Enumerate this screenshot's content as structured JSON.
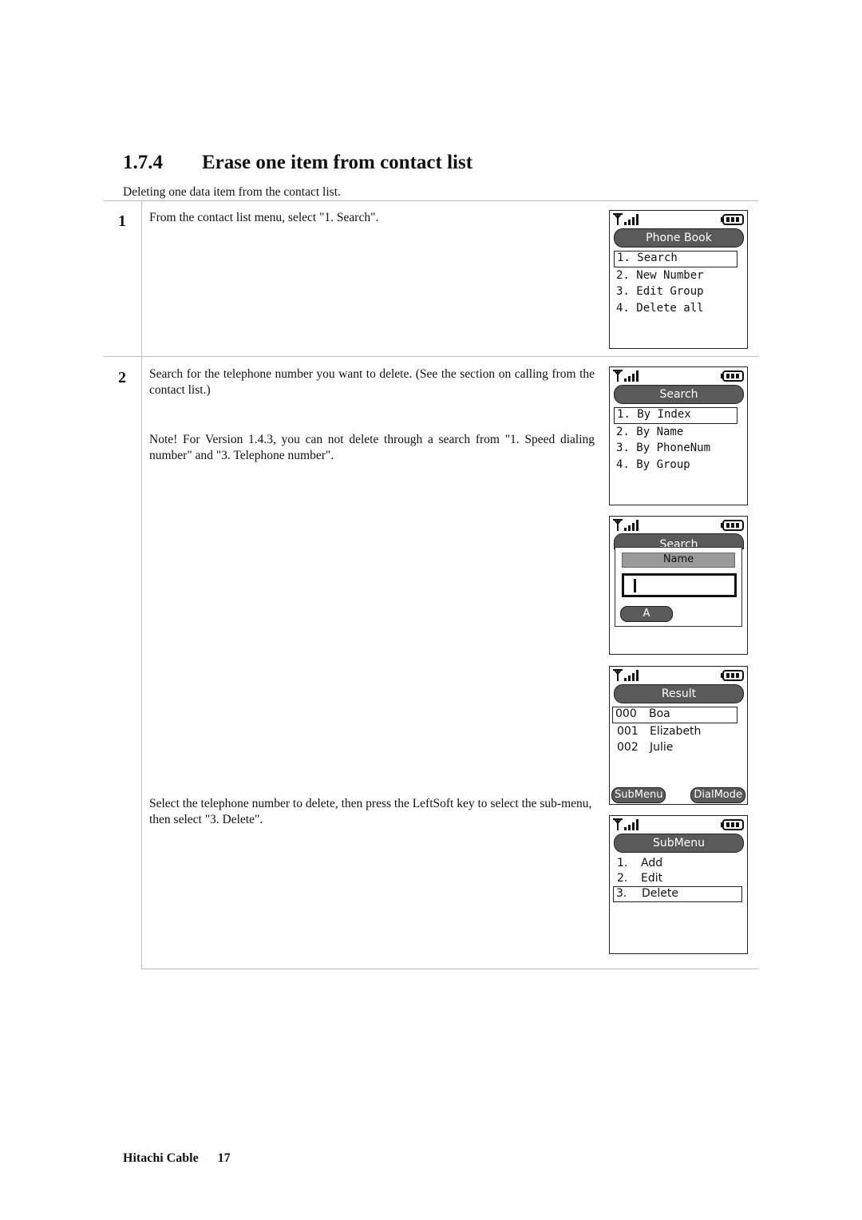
{
  "section": {
    "number": "1.7.4",
    "title": "Erase one item from contact list",
    "intro": "Deleting one data item from the contact list."
  },
  "steps": [
    {
      "number": "1",
      "paragraphs": [
        "From the contact list menu, select \"1. Search\"."
      ]
    },
    {
      "number": "2",
      "paragraphs": [
        "Search for the telephone number you want to delete. (See the section on calling from the contact list.)",
        "Note!  For Version 1.4.3, you can not delete through a search from \"1. Speed dialing number\" and \"3. Telephone number\".",
        "Select the telephone number to delete, then press the LeftSoft key to select the sub-menu, then select \"3. Delete\"."
      ]
    }
  ],
  "screens": {
    "phone_book": {
      "title": "Phone Book",
      "items": [
        "1. Search",
        "2. New Number",
        "3. Edit Group",
        "4. Delete all"
      ],
      "selected_index": 0
    },
    "search": {
      "title": "Search",
      "items": [
        "1. By Index",
        "2. By Name",
        "3. By PhoneNum",
        "4. By Group"
      ],
      "selected_index": 0
    },
    "search_name": {
      "title": "Search",
      "field_label": "Name",
      "input_value": "",
      "input_mode": "A"
    },
    "result": {
      "title": "Result",
      "rows": [
        {
          "index": "000",
          "name": "Boa"
        },
        {
          "index": "001",
          "name": "Elizabeth"
        },
        {
          "index": "002",
          "name": "Julie"
        }
      ],
      "selected_index": 0,
      "left_softkey": "SubMenu",
      "right_softkey": "DialMode"
    },
    "submenu": {
      "title": "SubMenu",
      "items": [
        {
          "index": "1.",
          "label": "Add"
        },
        {
          "index": "2.",
          "label": "Edit"
        },
        {
          "index": "3.",
          "label": "Delete"
        }
      ],
      "selected_index": 2
    }
  },
  "status_icons": [
    "signal-strength-icon",
    "battery-icon"
  ],
  "footer": {
    "company": "Hitachi Cable",
    "page": "17"
  }
}
